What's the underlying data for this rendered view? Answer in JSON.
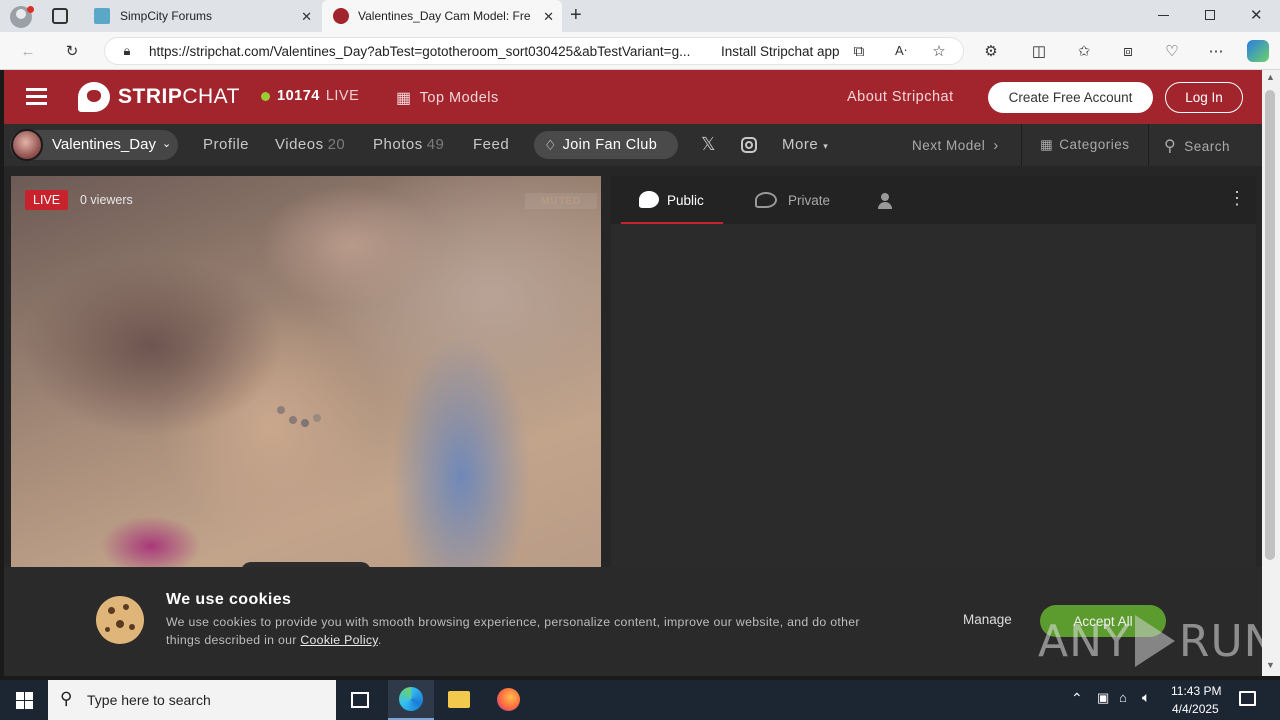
{
  "browser": {
    "tabs": [
      {
        "title": "SimpCity Forums"
      },
      {
        "title": "Valentines_Day Cam Model: Free"
      }
    ],
    "url": "https://stripchat.com/Valentines_Day?abTest=gototheroom_sort030425&abTestVariant=g...",
    "install_app_label": "Install Stripchat app"
  },
  "header": {
    "brand_strip": "STRIP",
    "brand_chat": "CHAT",
    "live_count": "10174",
    "live_label": "LIVE",
    "top_models": "Top Models",
    "about": "About Stripchat",
    "create_account": "Create Free Account",
    "login": "Log In"
  },
  "model_bar": {
    "username": "Valentines_Day",
    "profile": "Profile",
    "videos": "Videos",
    "videos_count": "20",
    "photos": "Photos",
    "photos_count": "49",
    "feed": "Feed",
    "join_fan_club": "Join Fan Club",
    "more": "More",
    "next_model": "Next Model",
    "categories": "Categories",
    "search": "Search"
  },
  "player": {
    "live_badge": "LIVE",
    "viewers": "0 viewers",
    "muted": "MUTED"
  },
  "chat": {
    "tab_public": "Public",
    "tab_private": "Private"
  },
  "cookie": {
    "title": "We use cookies",
    "text_line1": "We use cookies to provide you with smooth browsing experience, personalize content, improve our website, and do other",
    "text_line2": "things described in our",
    "policy_link": "Cookie Policy",
    "manage": "Manage",
    "accept": "Accept All"
  },
  "watermark": {
    "text_any": "ANY",
    "text_run": "RUN"
  },
  "taskbar": {
    "search_placeholder": "Type here to search",
    "time": "11:43 PM",
    "date": "4/4/2025"
  },
  "colors": {
    "brand_red": "#a2252d",
    "live_dot": "#9acd32",
    "accept_green": "#5c9b2e"
  }
}
